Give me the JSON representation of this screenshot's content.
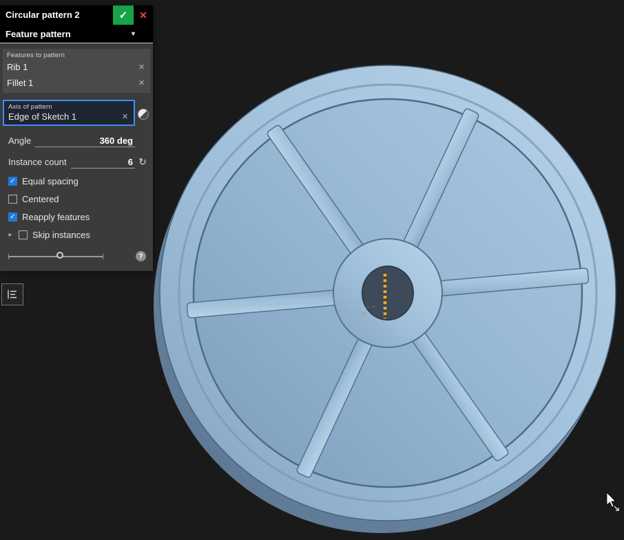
{
  "colors": {
    "canvas_bg": "#1a1a1a",
    "accent_blue": "#3f8cff",
    "confirm_green": "#18a24b",
    "close_red": "#e5473d",
    "checkbox_blue": "#1f7bd8",
    "axis_highlight": "#ffa51e",
    "wheel_face": "#9fbeda",
    "hole": "#3d4b58"
  },
  "icons": {
    "confirm": "✓",
    "close": "✕",
    "remove": "×",
    "caret": "▾",
    "reverse": "↻",
    "chevron": "▸",
    "check": "✓",
    "help": "?"
  },
  "dialog": {
    "title": "Circular pattern 2",
    "type_selector": "Feature pattern",
    "features_box": {
      "label": "Features to pattern",
      "items": [
        "Rib 1",
        "Fillet 1"
      ]
    },
    "axis_box": {
      "label": "Axis of pattern",
      "value": "Edge of Sketch 1"
    },
    "angle": {
      "label": "Angle",
      "value": "360 deg"
    },
    "instance_count": {
      "label": "Instance count",
      "value": "6"
    },
    "options": {
      "equal_spacing": "Equal spacing",
      "centered": "Centered",
      "reapply_features": "Reapply features",
      "skip_instances": "Skip instances"
    }
  }
}
